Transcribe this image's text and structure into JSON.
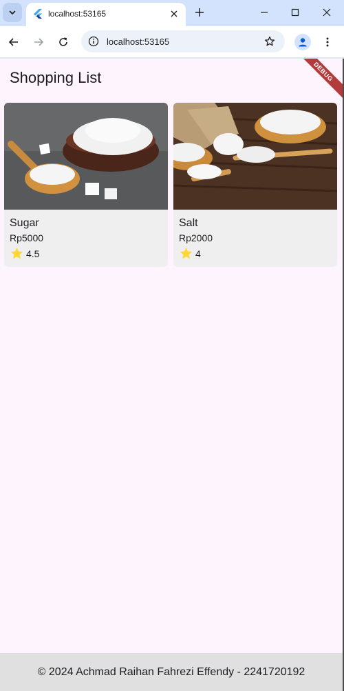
{
  "browser": {
    "tab_title": "localhost:53165",
    "url": "localhost:53165"
  },
  "app": {
    "title": "Shopping List",
    "debug_label": "DEBUG",
    "items": [
      {
        "name": "Sugar",
        "price": "Rp5000",
        "rating": "4.5",
        "image": "sugar-photo"
      },
      {
        "name": "Salt",
        "price": "Rp2000",
        "rating": "4",
        "image": "salt-photo"
      }
    ],
    "footer": "© 2024 Achmad Raihan Fahrezi Effendy - 2241720192"
  },
  "colors": {
    "app_background": "#fdf4fd",
    "card_background": "#efefef",
    "footer_background": "#e0e0e0",
    "star": "#fdd835",
    "debug_banner": "#b23b3b"
  }
}
